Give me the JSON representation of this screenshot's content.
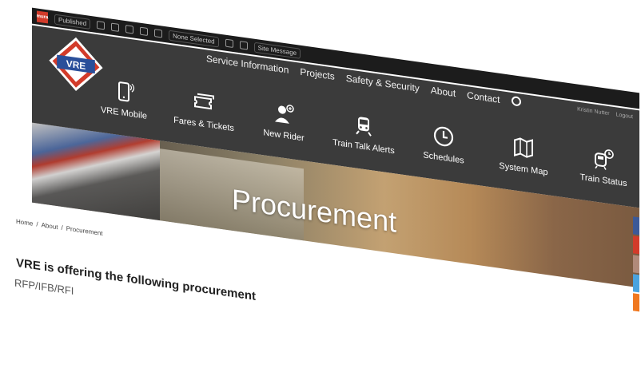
{
  "toolbar": {
    "status": "Published",
    "selection": "None Selected",
    "message": "Site Message",
    "user": "Kristin Nutter",
    "logout": "Logout"
  },
  "brand": {
    "logo_text": "VRE",
    "colors": {
      "red": "#d23b2a",
      "blue": "#2a4f9a"
    }
  },
  "topnav": [
    "Service Information",
    "Projects",
    "Safety & Security",
    "About",
    "Contact"
  ],
  "icon_menu": [
    {
      "label": "VRE Mobile",
      "icon": "phone-icon"
    },
    {
      "label": "Fares & Tickets",
      "icon": "tickets-icon"
    },
    {
      "label": "New Rider",
      "icon": "new-rider-icon"
    },
    {
      "label": "Train Talk Alerts",
      "icon": "train-alert-icon"
    },
    {
      "label": "Schedules",
      "icon": "clock-icon"
    },
    {
      "label": "System Map",
      "icon": "map-icon"
    },
    {
      "label": "Train Status",
      "icon": "train-status-icon"
    }
  ],
  "hero": {
    "title": "Procurement"
  },
  "breadcrumb": [
    "Home",
    "About",
    "Procurement"
  ],
  "content": {
    "heading": "VRE is offering the following procurement",
    "sub": "RFP/IFB/RFI"
  }
}
